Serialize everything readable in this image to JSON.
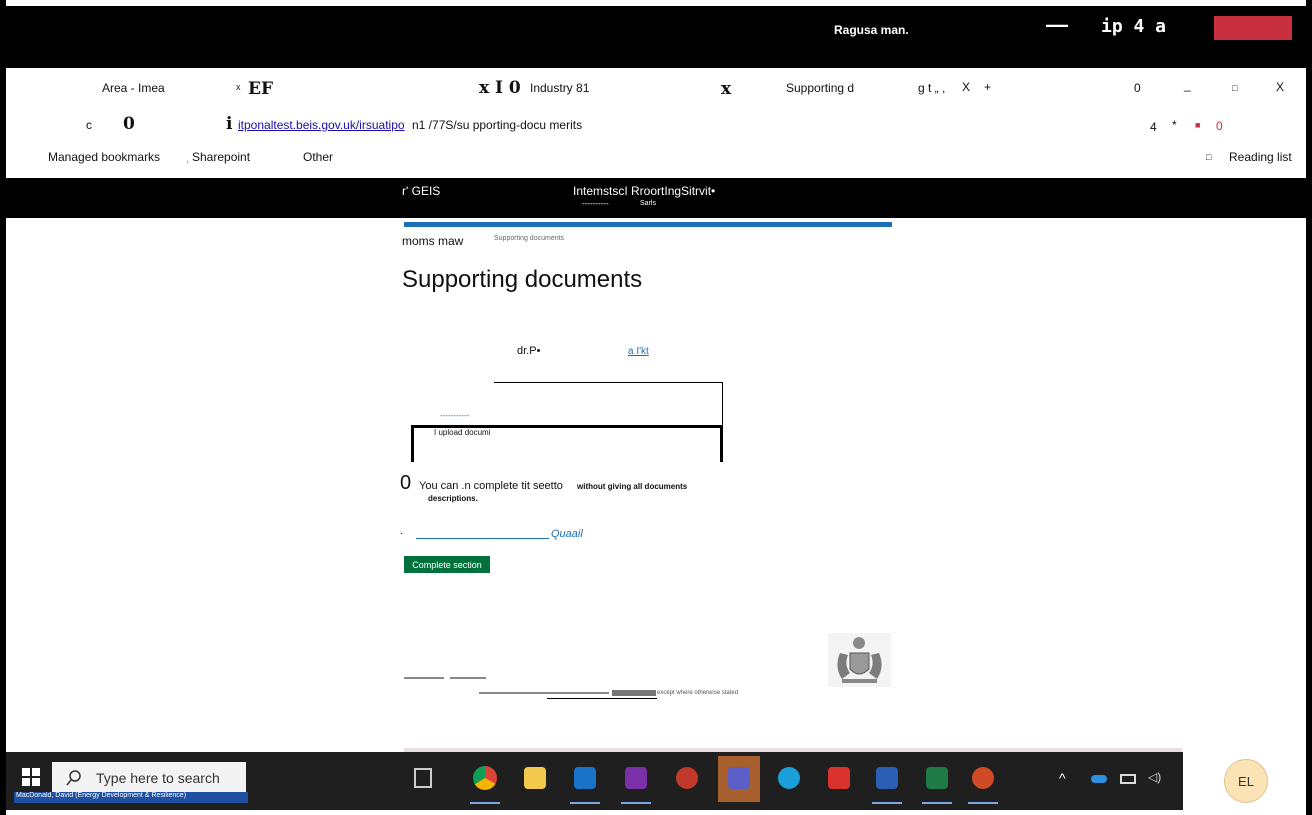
{
  "window": {
    "title": "Ragusa man.",
    "minimize_glyph": "—",
    "title_right": "ip 4 a"
  },
  "tabs": {
    "tab1_label": "Area - Imea",
    "tab1_close": "x",
    "tab1_extra": "EF",
    "tab2_glyph": "x I 0",
    "tab2_label": "Industry 81",
    "tab3_close": "x",
    "tab3_label": "Supporting d",
    "tab3_extra": "g t „ ,",
    "tab3_x": "X",
    "new_tab": "+",
    "right_zero": "0",
    "min": "_",
    "max": "□",
    "close": "X"
  },
  "address": {
    "back": "c",
    "refresh": "0",
    "info_icon": "i",
    "url_link": "itponaltest.beis.gov.uk/irsuatipo",
    "url_rest": "n1 /77S/su pporting-docu merits",
    "right_4": "4",
    "right_star": "*",
    "right_square": "■",
    "right_zero": "0"
  },
  "bookmarks": {
    "items": [
      "Managed bookmarks",
      "Sharepoint",
      "Other"
    ],
    "sep": ",",
    "reading_list_icon": "□",
    "reading_list": "Reading list"
  },
  "site": {
    "logo": "r' GEIS",
    "service_name": "IntemstscI RroortIngSitrvit•",
    "sub_dashes": "----------",
    "sub_label": "Sarls"
  },
  "breadcrumb": {
    "home": "moms maw",
    "current": "Supporting documents"
  },
  "page": {
    "heading": "Supporting documents",
    "table_col1": "dr.P•",
    "table_col2": "a I'kt",
    "upload_dashes": "-----------",
    "upload_label": "I upload documi",
    "warning_glyph": "0",
    "warning_text": "You can .n complete tit seetto",
    "warning_bold": "without giving all documents",
    "warning_bold2": "descriptions.",
    "bullet": "·",
    "link_text": "Quaail",
    "complete_button": "Complete section"
  },
  "footer": {
    "licence_text": "except where otherwise stated"
  },
  "taskbar": {
    "search_placeholder": "Type here to search",
    "user_label": "MacDonald, David (Energy Development & Resilience)",
    "avatar_initials": "EL",
    "apps": [
      "task-view-icon",
      "chrome-icon",
      "file-explorer-icon",
      "outlook-icon",
      "onenote-icon",
      "snip-icon",
      "teams-icon",
      "edge-icon",
      "acrobat-icon",
      "word-icon",
      "excel-icon",
      "powerpoint-icon"
    ],
    "colors": {
      "accent": "#1d70b8",
      "green": "#00703c",
      "close_red": "#c8303f"
    }
  }
}
